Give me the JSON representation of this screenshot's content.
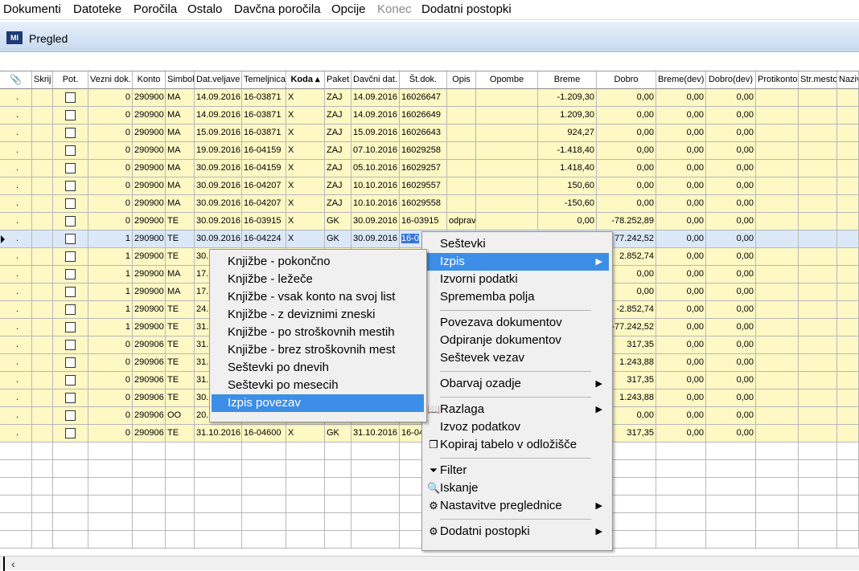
{
  "menubar": {
    "items": [
      "Dokumenti",
      "Datoteke",
      "Poročila",
      "Ostalo",
      "Davčna poročila",
      "Opcije",
      "Konec",
      "Dodatni postopki"
    ]
  },
  "window": {
    "title": "Pregled"
  },
  "grid": {
    "columns": [
      "",
      "Skrij",
      "Pot.",
      "Vezni dok.",
      "Konto",
      "Simbol",
      "Dat.veljave",
      "Temeljnica",
      "Koda",
      "Paket",
      "Davčni dat.",
      "Št.dok.",
      "Opis",
      "Opombe",
      "Breme",
      "Dobro",
      "Breme(dev)",
      "Dobro(dev)",
      "Protikonto",
      "Str.mesto",
      "Naziv"
    ],
    "sorted_column": "Koda",
    "rows": [
      [
        ".",
        "",
        "",
        "0",
        "290900",
        "MA",
        "14.09.2016",
        "16-03871",
        "X",
        "ZAJ",
        "14.09.2016",
        "16026647",
        "",
        "",
        "-1.209,30",
        "0,00",
        "0,00",
        "0,00",
        "",
        "",
        ""
      ],
      [
        ".",
        "",
        "",
        "0",
        "290900",
        "MA",
        "14.09.2016",
        "16-03871",
        "X",
        "ZAJ",
        "14.09.2016",
        "16026649",
        "",
        "",
        "1.209,30",
        "0,00",
        "0,00",
        "0,00",
        "",
        "",
        ""
      ],
      [
        ".",
        "",
        "",
        "0",
        "290900",
        "MA",
        "15.09.2016",
        "16-03871",
        "X",
        "ZAJ",
        "15.09.2016",
        "16026643",
        "",
        "",
        "924,27",
        "0,00",
        "0,00",
        "0,00",
        "",
        "",
        ""
      ],
      [
        ".",
        "",
        "",
        "0",
        "290900",
        "MA",
        "19.09.2016",
        "16-04159",
        "X",
        "ZAJ",
        "07.10.2016",
        "16029258",
        "",
        "",
        "-1.418,40",
        "0,00",
        "0,00",
        "0,00",
        "",
        "",
        ""
      ],
      [
        ".",
        "",
        "",
        "0",
        "290900",
        "MA",
        "30.09.2016",
        "16-04159",
        "X",
        "ZAJ",
        "05.10.2016",
        "16029257",
        "",
        "",
        "1.418,40",
        "0,00",
        "0,00",
        "0,00",
        "",
        "",
        ""
      ],
      [
        ".",
        "",
        "",
        "0",
        "290900",
        "MA",
        "30.09.2016",
        "16-04207",
        "X",
        "ZAJ",
        "10.10.2016",
        "16029557",
        "",
        "",
        "150,60",
        "0,00",
        "0,00",
        "0,00",
        "",
        "",
        ""
      ],
      [
        ".",
        "",
        "",
        "0",
        "290900",
        "MA",
        "30.09.2016",
        "16-04207",
        "X",
        "ZAJ",
        "10.10.2016",
        "16029558",
        "",
        "",
        "-150,60",
        "0,00",
        "0,00",
        "0,00",
        "",
        "",
        ""
      ],
      [
        ".",
        "",
        "",
        "0",
        "290900",
        "TE",
        "30.09.2016",
        "16-03915",
        "X",
        "GK",
        "30.09.2016",
        "16-03915",
        "odprav",
        "",
        "0,00",
        "-78.252,89",
        "0,00",
        "0,00",
        "",
        "",
        ""
      ],
      [
        ".",
        "",
        "",
        "1",
        "290900",
        "TE",
        "30.09.2016",
        "16-04224",
        "X",
        "GK",
        "30.09.2016",
        "16-0",
        "",
        "",
        "",
        "77.242,52",
        "0,00",
        "0,00",
        "",
        "",
        ""
      ],
      [
        ".",
        "",
        "",
        "1",
        "290900",
        "TE",
        "30.",
        "",
        "",
        "",
        "",
        "",
        "",
        "",
        "",
        "2.852,74",
        "0,00",
        "0,00",
        "",
        "",
        ""
      ],
      [
        ".",
        "",
        "",
        "1",
        "290900",
        "MA",
        "17.",
        "",
        "",
        "",
        "",
        "",
        "",
        "",
        "",
        "0,00",
        "0,00",
        "0,00",
        "",
        "",
        ""
      ],
      [
        ".",
        "",
        "",
        "1",
        "290900",
        "MA",
        "17.",
        "",
        "",
        "",
        "",
        "",
        "",
        "",
        "",
        "0,00",
        "0,00",
        "0,00",
        "",
        "",
        ""
      ],
      [
        ".",
        "",
        "",
        "1",
        "290900",
        "TE",
        "24.",
        "",
        "",
        "",
        "",
        "",
        "",
        "",
        "",
        "-2.852,74",
        "0,00",
        "0,00",
        "",
        "",
        ""
      ],
      [
        ".",
        "",
        "",
        "1",
        "290900",
        "TE",
        "31.",
        "",
        "",
        "",
        "",
        "",
        "",
        "",
        "",
        "-77.242,52",
        "0,00",
        "0,00",
        "",
        "",
        ""
      ],
      [
        ".",
        "",
        "",
        "0",
        "290906",
        "TE",
        "31.",
        "",
        "",
        "",
        "",
        "",
        "",
        "",
        "",
        "317,35",
        "0,00",
        "0,00",
        "",
        "",
        ""
      ],
      [
        ".",
        "",
        "",
        "0",
        "290906",
        "TE",
        "31.",
        "",
        "",
        "",
        "",
        "",
        "",
        "",
        "",
        "1.243,88",
        "0,00",
        "0,00",
        "",
        "",
        ""
      ],
      [
        ".",
        "",
        "",
        "0",
        "290906",
        "TE",
        "31.",
        "",
        "",
        "",
        "",
        "",
        "",
        "",
        "",
        "317,35",
        "0,00",
        "0,00",
        "",
        "",
        ""
      ],
      [
        ".",
        "",
        "",
        "0",
        "290906",
        "TE",
        "30.",
        "",
        "",
        "",
        "",
        "",
        "",
        "",
        "",
        "1.243,88",
        "0,00",
        "0,00",
        "",
        "",
        ""
      ],
      [
        ".",
        "",
        "",
        "0",
        "290906",
        "OO",
        "20.",
        "",
        "",
        "",
        "",
        "",
        "",
        "",
        "",
        "0,00",
        "0,00",
        "0,00",
        "",
        "",
        ""
      ],
      [
        ".",
        "",
        "",
        "0",
        "290906",
        "TE",
        "31.10.2016",
        "16-04600",
        "X",
        "GK",
        "31.10.2016",
        "16-04",
        "",
        "",
        "",
        "317,35",
        "0,00",
        "0,00",
        "",
        "",
        ""
      ]
    ],
    "selected_row": 8,
    "empty_rows": 6
  },
  "context_menu": {
    "items": [
      {
        "label": "Seštevki",
        "sub": false,
        "icon": ""
      },
      {
        "label": "Izpis",
        "sub": true,
        "icon": "",
        "highlight": true
      },
      {
        "label": "Izvorni podatki",
        "sub": false,
        "icon": ""
      },
      {
        "label": "Sprememba polja",
        "sub": false,
        "icon": ""
      },
      {
        "sep": true
      },
      {
        "label": "Povezava dokumentov",
        "sub": false,
        "icon": ""
      },
      {
        "label": "Odpiranje dokumentov",
        "sub": false,
        "icon": ""
      },
      {
        "label": "Seštevek vezav",
        "sub": false,
        "icon": ""
      },
      {
        "sep": true
      },
      {
        "label": "Obarvaj ozadje",
        "sub": true,
        "icon": ""
      },
      {
        "sep": true
      },
      {
        "label": "Razlaga",
        "sub": true,
        "icon": "book-icon"
      },
      {
        "label": "Izvoz podatkov",
        "sub": false,
        "icon": ""
      },
      {
        "label": "Kopiraj tabelo v odložišče",
        "sub": false,
        "icon": "copy-icon"
      },
      {
        "sep": true
      },
      {
        "label": "Filter",
        "sub": false,
        "icon": "filter-icon"
      },
      {
        "label": "Iskanje",
        "sub": false,
        "icon": "search-icon"
      },
      {
        "label": "Nastavitve preglednice",
        "sub": true,
        "icon": "settings-icon"
      },
      {
        "sep": true
      },
      {
        "label": "Dodatni postopki",
        "sub": true,
        "icon": "tools-icon"
      }
    ]
  },
  "submenu": {
    "items": [
      {
        "label": "Knjižbe - pokončno"
      },
      {
        "label": "Knjižbe - ležeče"
      },
      {
        "label": "Knjižbe - vsak konto na svoj list"
      },
      {
        "label": "Knjižbe - z deviznimi zneski"
      },
      {
        "label": "Knjižbe - po stroškovnih mestih"
      },
      {
        "label": "Knjižbe - brez stroškovnih mest"
      },
      {
        "label": "Seštevki po dnevih"
      },
      {
        "label": "Seštevki po mesecih"
      },
      {
        "label": "Izpis povezav",
        "highlight": true
      }
    ]
  },
  "colors": {
    "row_bg": "#fdf8c4",
    "highlight": "#3d8ee6"
  }
}
